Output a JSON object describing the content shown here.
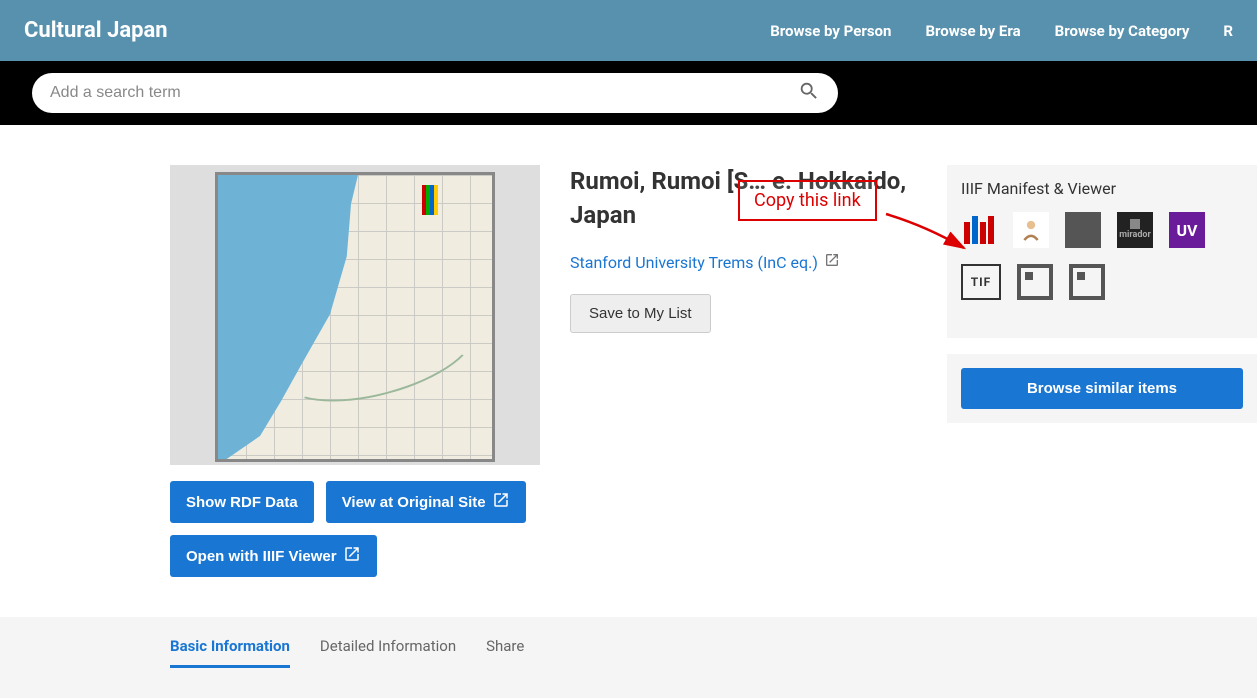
{
  "header": {
    "logo": "Cultural Japan",
    "nav": [
      "Browse by Person",
      "Browse by Era",
      "Browse by Category",
      "R"
    ]
  },
  "search": {
    "placeholder": "Add a search term"
  },
  "item": {
    "title": "Rumoi, Rumoi [S… e. Hokkaido, Japan",
    "source_label": "Stanford University Trems (InC eq.)",
    "save_label": "Save to My List"
  },
  "buttons": {
    "rdf": "Show RDF Data",
    "original": "View at Original Site",
    "iiif_viewer": "Open with IIIF Viewer"
  },
  "sidebar": {
    "title": "IIIF Manifest & Viewer",
    "icons": {
      "iiif": "iiif-logo",
      "curation": "curation-viewer",
      "mirador_grey": "mirador",
      "mirador_dark": "mirador-dark",
      "uv": "UV",
      "tify": "TIF"
    },
    "browse": "Browse similar items"
  },
  "annotation": {
    "text": "Copy this link"
  },
  "tabs": {
    "basic": "Basic Information",
    "detailed": "Detailed Information",
    "share": "Share"
  }
}
